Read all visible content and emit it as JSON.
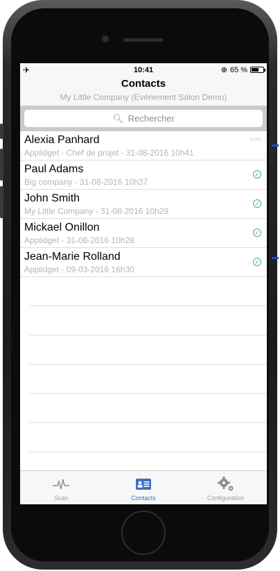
{
  "status_bar": {
    "left_icon": "airplane-icon",
    "time": "10:41",
    "battery_text": "65 %",
    "battery_level": 0.65
  },
  "header": {
    "title": "Contacts",
    "subtitle": "My Little Company (Evénement Salon Demo)"
  },
  "search": {
    "placeholder": "Rechercher"
  },
  "contacts": [
    {
      "name": "Alexia Panhard",
      "meta": "Applidget - Chef de projet - 31-08-2016 10h41",
      "status": "pending"
    },
    {
      "name": "Paul Adams",
      "meta": "Big company - 31-08-2016 10h37",
      "status": "synced"
    },
    {
      "name": "John Smith",
      "meta": "My Little Company - 31-08-2016 10h29",
      "status": "synced"
    },
    {
      "name": "Mickael Onillon",
      "meta": "Applidget - 31-08-2016 10h28",
      "status": "synced"
    },
    {
      "name": "Jean-Marie Rolland",
      "meta": "Applidget - 09-03-2016 16h30",
      "status": "synced"
    }
  ],
  "tabbar": {
    "tabs": [
      {
        "label": "Scan",
        "icon": "pulse-icon",
        "active": false
      },
      {
        "label": "Contacts",
        "icon": "contact-card-icon",
        "active": true
      },
      {
        "label": "Configuration",
        "icon": "gears-icon",
        "active": false
      }
    ]
  },
  "colors": {
    "accent": "#3b6fc7",
    "synced": "#3cb371"
  }
}
